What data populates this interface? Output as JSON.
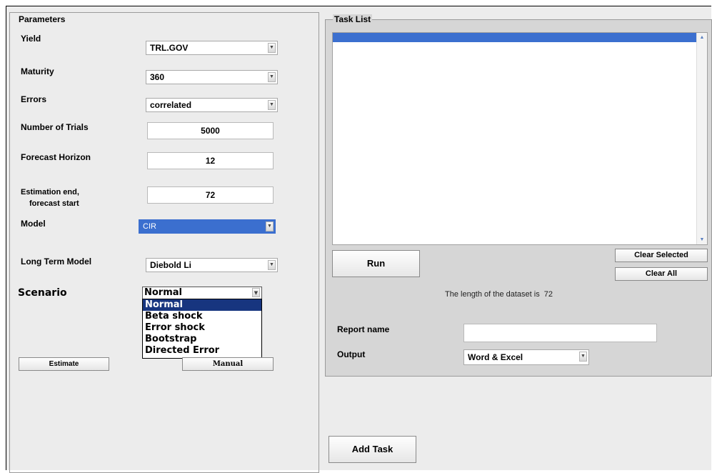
{
  "parameters": {
    "title": "Parameters",
    "yield": {
      "label": "Yield",
      "value": "TRL.GOV"
    },
    "maturity": {
      "label": "Maturity",
      "value": "360"
    },
    "errors": {
      "label": "Errors",
      "value": "correlated"
    },
    "trials": {
      "label": "Number of Trials",
      "value": "5000"
    },
    "horizon": {
      "label": "Forecast Horizon",
      "value": "12"
    },
    "estimation_end": {
      "label_line1": "Estimation end,",
      "label_line2": "forecast start",
      "value": "72"
    },
    "model": {
      "label": "Model",
      "value": "CIR"
    },
    "long_term_model": {
      "label": "Long Term Model",
      "value": "Diebold Li"
    },
    "scenario": {
      "label": "Scenario",
      "value": "Normal",
      "options": [
        "Normal",
        "Beta shock",
        "Error shock",
        "Bootstrap",
        "Directed Error"
      ]
    },
    "estimate_button": "Estimate",
    "manual_button": "Manual"
  },
  "task_list": {
    "title": "Task List",
    "run_button": "Run",
    "clear_selected_button": "Clear Selected",
    "clear_all_button": "Clear All",
    "dataset_info": "The length of the dataset is  72",
    "report_name": {
      "label": "Report name",
      "value": ""
    },
    "output": {
      "label": "Output",
      "value": "Word & Excel"
    }
  },
  "add_task_button": "Add Task",
  "icons": {
    "scroll_up": "▲",
    "scroll_down": "▼",
    "combo_arrow": "▼"
  },
  "colors": {
    "selection": "#3b6fcf",
    "dropdown_selected": "#17357f",
    "panel_bg": "#ececec"
  }
}
